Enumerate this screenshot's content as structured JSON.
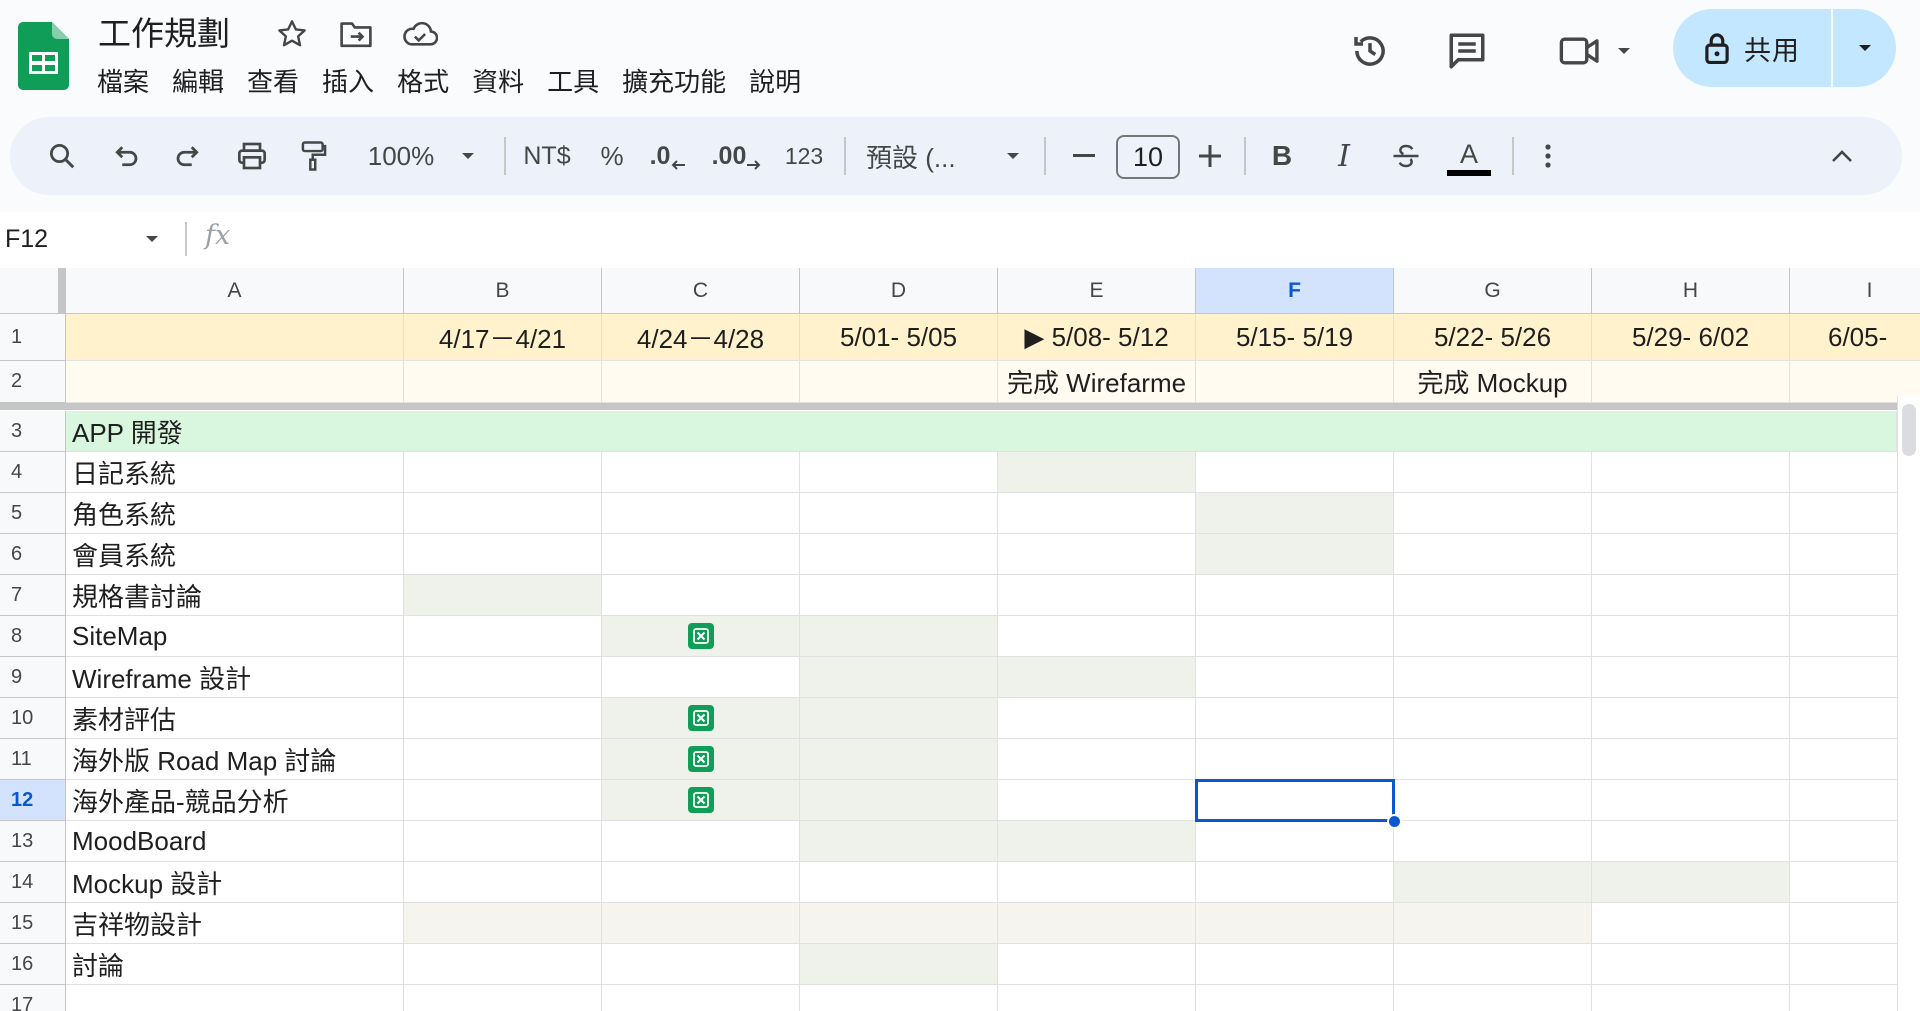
{
  "app": {
    "title": "工作規劃",
    "menu": [
      "檔案",
      "編輯",
      "查看",
      "插入",
      "格式",
      "資料",
      "工具",
      "擴充功能",
      "說明"
    ],
    "share_label": "共用",
    "logo_icon": "sheets-logo-icon"
  },
  "toolbar": {
    "zoom": "100%",
    "currency": "NT$",
    "percent": "%",
    "decrease_decimal": ".0",
    "increase_decimal": ".00",
    "number_format": "123",
    "font": "預設 (...",
    "font_size": "10",
    "bold": "B",
    "italic": "I",
    "text_color_letter": "A"
  },
  "formula_bar": {
    "cell_ref": "F12",
    "fx": "fx"
  },
  "grid": {
    "columns": [
      "A",
      "B",
      "C",
      "D",
      "E",
      "F",
      "G",
      "H",
      "I"
    ],
    "selected_column": "F",
    "rows": [
      "1",
      "2",
      "3",
      "4",
      "5",
      "6",
      "7",
      "8",
      "9",
      "10",
      "11",
      "12",
      "13",
      "14",
      "15",
      "16",
      "17"
    ],
    "selected_row": "12",
    "week_headers": [
      "4/17－4/21",
      "4/24－4/28",
      "5/01- 5/05",
      "▶ 5/08- 5/12",
      "5/15- 5/19",
      "5/22- 5/26",
      "5/29- 6/02",
      "6/05-"
    ],
    "milestones": {
      "E": "完成 Wirefarme",
      "G": "完成 Mockup"
    },
    "section_title": "APP 開發",
    "tasks": [
      {
        "name": "日記系統",
        "fill": [
          "E"
        ]
      },
      {
        "name": "角色系統",
        "fill": [
          "F"
        ]
      },
      {
        "name": "會員系統",
        "fill": [
          "F"
        ]
      },
      {
        "name": "規格書討論",
        "fill": [
          "B"
        ]
      },
      {
        "name": "SiteMap",
        "fill": [
          "C",
          "D"
        ],
        "check": [
          "C"
        ]
      },
      {
        "name": "Wireframe 設計",
        "fill": [
          "D",
          "E"
        ]
      },
      {
        "name": "素材評估",
        "fill": [
          "C",
          "D"
        ],
        "check": [
          "C"
        ]
      },
      {
        "name": "海外版 Road Map 討論",
        "fill": [
          "C",
          "D"
        ],
        "check": [
          "C"
        ]
      },
      {
        "name": "海外產品-競品分析",
        "fill": [
          "C",
          "D"
        ],
        "check": [
          "C"
        ]
      },
      {
        "name": "MoodBoard",
        "fill": [
          "D",
          "E"
        ]
      },
      {
        "name": "Mockup 設計",
        "fill": [
          "G",
          "H"
        ]
      },
      {
        "name": "吉祥物設計",
        "fill": [
          "B",
          "C",
          "D",
          "E",
          "F",
          "G"
        ],
        "fill_style": "light"
      },
      {
        "name": "討論",
        "fill": [
          "D"
        ]
      }
    ]
  },
  "colors": {
    "header_row": "#fff2cc",
    "milestone_row": "#fffbf0",
    "section_row": "#d9f7de",
    "task_fill": "#eef2ea",
    "task_fill_light": "#f6f4ef",
    "selection": "#0b57d0",
    "checkbox": "#0f9d58",
    "share_button": "#c2e7ff"
  }
}
